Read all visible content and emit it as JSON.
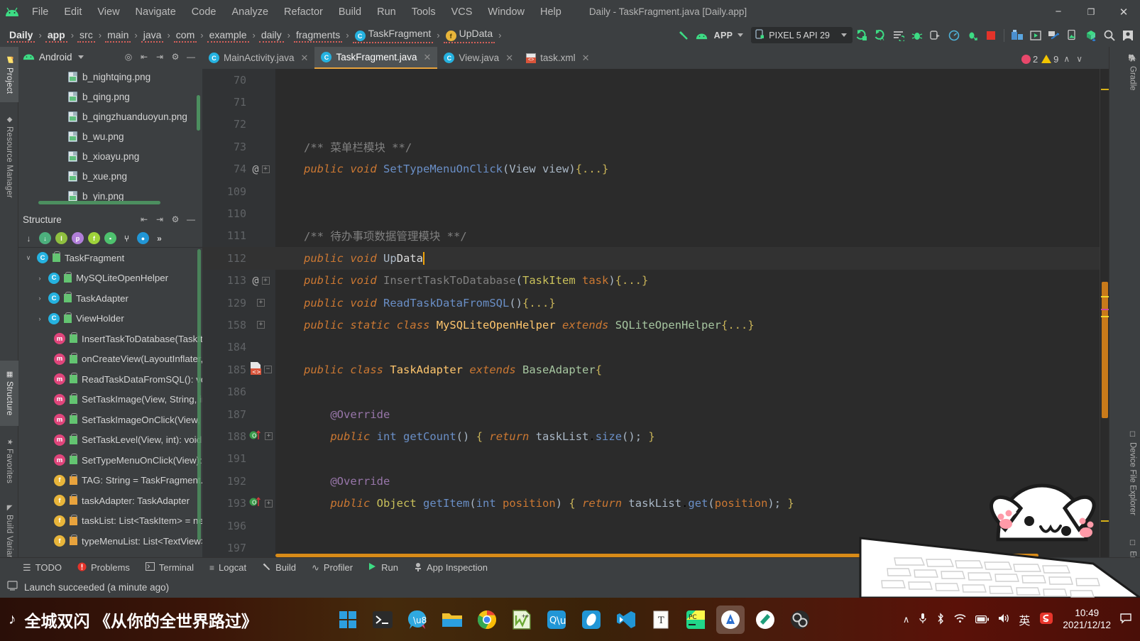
{
  "window": {
    "title": "Daily - TaskFragment.java [Daily.app]",
    "minimize": "−",
    "maximize": "❐",
    "close": "✕"
  },
  "menu": {
    "items": [
      "File",
      "Edit",
      "View",
      "Navigate",
      "Code",
      "Analyze",
      "Refactor",
      "Build",
      "Run",
      "Tools",
      "VCS",
      "Window",
      "Help"
    ]
  },
  "breadcrumb": {
    "items": [
      {
        "label": "Daily",
        "bold": true,
        "icon": null
      },
      {
        "label": "app",
        "bold": true,
        "icon": null
      },
      {
        "label": "src",
        "bold": false,
        "icon": null
      },
      {
        "label": "main",
        "bold": false,
        "icon": null
      },
      {
        "label": "java",
        "bold": false,
        "icon": null
      },
      {
        "label": "com",
        "bold": false,
        "icon": null
      },
      {
        "label": "example",
        "bold": false,
        "icon": null
      },
      {
        "label": "daily",
        "bold": false,
        "icon": null
      },
      {
        "label": "fragments",
        "bold": false,
        "icon": null
      },
      {
        "label": "TaskFragment",
        "bold": false,
        "icon": "class-icon"
      },
      {
        "label": "UpData",
        "bold": false,
        "icon": "field-icon"
      }
    ],
    "separator": "›"
  },
  "toolbar": {
    "build_label": "build-hammer-icon",
    "sync_label": "sync-gradle-icon",
    "run_config": "APP",
    "device": "PIXEL 5 API 29",
    "icons": [
      "run-icon",
      "run-coverage-icon",
      "apply-changes-icon",
      "debug-icon",
      "attach-debugger-icon",
      "profiler-icon",
      "apply-code-changes-icon",
      "stop-icon",
      "sdk-manager-icon",
      "avd-manager-icon",
      "layout-inspector-icon",
      "device-manager-icon",
      "project-structure-icon",
      "search-everywhere-icon",
      "account-icon"
    ]
  },
  "left_strip": {
    "tabs": [
      {
        "label": "Project",
        "icon": "folder-icon",
        "selected": true
      },
      {
        "label": "Resource Manager",
        "icon": "resource-icon",
        "selected": false
      },
      {
        "label": "Structure",
        "icon": "structure-icon",
        "selected": true
      },
      {
        "label": "Favorites",
        "icon": "star-icon",
        "selected": false
      },
      {
        "label": "Build Variants",
        "icon": "variants-icon",
        "selected": false
      }
    ]
  },
  "right_strip": {
    "tabs": [
      {
        "label": "Gradle",
        "icon": "gradle-elephant-icon"
      },
      {
        "label": "Device File Explorer",
        "icon": "device-file-icon"
      },
      {
        "label": "Emulator",
        "icon": "emulator-icon"
      }
    ]
  },
  "project_panel": {
    "title": "Android",
    "tools": [
      "locate-icon",
      "expand-all-icon",
      "collapse-all-icon",
      "settings-icon",
      "hide-icon"
    ],
    "files": [
      "b_nightqing.png",
      "b_qing.png",
      "b_qingzhuanduoyun.png",
      "b_wu.png",
      "b_xioayu.png",
      "b_xue.png",
      "b_yin.png"
    ]
  },
  "structure_panel": {
    "title": "Structure",
    "tools": [
      "expand-all-icon",
      "collapse-all-icon",
      "settings-icon",
      "hide-icon"
    ],
    "filters": [
      {
        "name": "sort-by-visibility-icon",
        "color": "#3c3f41",
        "glyph": "↓"
      },
      {
        "name": "sort-alphabetically-icon",
        "color": "#4caf7d",
        "glyph": "↓"
      },
      {
        "name": "show-inherited-icon",
        "color": "#8fbf3f",
        "glyph": "I"
      },
      {
        "name": "show-properties-icon",
        "color": "#b07ed8",
        "glyph": "p"
      },
      {
        "name": "show-fields-icon",
        "color": "#9fd33a",
        "glyph": "f"
      },
      {
        "name": "show-non-public-icon",
        "color": "#4ec16e",
        "glyph": "▪"
      },
      {
        "name": "show-hierarchy-icon",
        "color": "#3c3f41",
        "glyph": "⑂"
      },
      {
        "name": "show-anonymous-icon",
        "color": "#2196d6",
        "glyph": "●"
      },
      {
        "name": "more-icon",
        "color": "#3c3f41",
        "glyph": "»"
      }
    ],
    "nodes": [
      {
        "arrow": "∨",
        "kind": "C",
        "kcolor": "#25b2e0",
        "lock": "green",
        "label": "TaskFragment",
        "indent": 8
      },
      {
        "arrow": "›",
        "kind": "C",
        "kcolor": "#25b2e0",
        "lock": "green",
        "label": "MySQLiteOpenHelper",
        "indent": 24
      },
      {
        "arrow": "›",
        "kind": "C",
        "kcolor": "#25b2e0",
        "lock": "green",
        "label": "TaskAdapter",
        "indent": 24
      },
      {
        "arrow": "›",
        "kind": "C",
        "kcolor": "#25b2e0",
        "lock": "green",
        "label": "ViewHolder",
        "indent": 24
      },
      {
        "arrow": "",
        "kind": "m",
        "kcolor": "#e0457b",
        "lock": "green",
        "label": "InsertTaskToDatabase(TaskItem",
        "indent": 32
      },
      {
        "arrow": "",
        "kind": "m",
        "kcolor": "#e0457b",
        "lock": "green",
        "label": "onCreateView(LayoutInflater, Vi",
        "indent": 32
      },
      {
        "arrow": "",
        "kind": "m",
        "kcolor": "#e0457b",
        "lock": "green",
        "label": "ReadTaskDataFromSQL(): void",
        "indent": 32
      },
      {
        "arrow": "",
        "kind": "m",
        "kcolor": "#e0457b",
        "lock": "green",
        "label": "SetTaskImage(View, String, int):",
        "indent": 32
      },
      {
        "arrow": "",
        "kind": "m",
        "kcolor": "#e0457b",
        "lock": "green",
        "label": "SetTaskImageOnClick(View, Stri",
        "indent": 32
      },
      {
        "arrow": "",
        "kind": "m",
        "kcolor": "#e0457b",
        "lock": "green",
        "label": "SetTaskLevel(View, int): void",
        "indent": 32
      },
      {
        "arrow": "",
        "kind": "m",
        "kcolor": "#e0457b",
        "lock": "green",
        "label": "SetTypeMenuOnClick(View): vo",
        "indent": 32
      },
      {
        "arrow": "",
        "kind": "f",
        "kcolor": "#e8b53a",
        "lock": "orange",
        "label": "TAG: String = TaskFragment.cla",
        "indent": 32
      },
      {
        "arrow": "",
        "kind": "f",
        "kcolor": "#e8b53a",
        "lock": "orange",
        "label": "taskAdapter: TaskAdapter",
        "indent": 32
      },
      {
        "arrow": "",
        "kind": "f",
        "kcolor": "#e8b53a",
        "lock": "orange",
        "label": "taskList: List<TaskItem> = new",
        "indent": 32
      },
      {
        "arrow": "",
        "kind": "f",
        "kcolor": "#e8b53a",
        "lock": "orange",
        "label": "typeMenuList: List<TextView>",
        "indent": 32
      }
    ]
  },
  "editor": {
    "tabs": [
      {
        "label": "MainActivity.java",
        "icon": "java-class-icon",
        "active": false,
        "close": "✕"
      },
      {
        "label": "TaskFragment.java",
        "icon": "java-class-icon",
        "active": true,
        "close": "✕"
      },
      {
        "label": "View.java",
        "icon": "java-class-icon",
        "active": false,
        "close": "✕"
      },
      {
        "label": "task.xml",
        "icon": "xml-layout-icon",
        "active": false,
        "close": "✕"
      }
    ],
    "inspections": {
      "error_count": "2",
      "warning_count": "9",
      "prev": "∧",
      "next": "∨"
    },
    "lines": [
      {
        "num": "70",
        "gutter": "",
        "fold": false,
        "current": false,
        "html": ""
      },
      {
        "num": "71",
        "gutter": "",
        "fold": false,
        "current": false,
        "html": ""
      },
      {
        "num": "72",
        "gutter": "",
        "fold": false,
        "current": false,
        "html": ""
      },
      {
        "num": "73",
        "gutter": "",
        "fold": false,
        "current": false,
        "html": "<span class='cmt'>/** 菜单栏模块 **/</span>"
      },
      {
        "num": "74",
        "gutter": "@",
        "fold": true,
        "current": false,
        "html": "<span class='kw'>public</span> <span class='kw'>void</span> <span class='mth2'>SetTypeMenuOnClick</span><span class='brc'>(</span><span class='typ'>View</span> <span class='pln'>view</span><span class='brc'>)</span><span class='yel'>{...}</span>"
      },
      {
        "num": "109",
        "gutter": "",
        "fold": false,
        "current": false,
        "html": ""
      },
      {
        "num": "110",
        "gutter": "",
        "fold": false,
        "current": false,
        "html": ""
      },
      {
        "num": "111",
        "gutter": "",
        "fold": false,
        "current": false,
        "html": "<span class='cmt'>/** 待办事项数据管理模块 **/</span>"
      },
      {
        "num": "112",
        "gutter": "",
        "fold": false,
        "current": true,
        "html": "<span class='kw'>public</span> <span class='kw'>void</span> <span class='pln'>Up</span><span class='pln' style='color:#dcdcdc'>Data</span><span class='cursor'></span>"
      },
      {
        "num": "113",
        "gutter": "@",
        "fold": true,
        "current": false,
        "html": "<span class='kw'>public</span> <span class='kw'>void</span> <span class='gry'>InsertTaskToDatabase</span><span class='brc'>(</span><span class='typ' style='color:#c9c05a'>TaskItem</span> <span class='pln' style='color:#cc7832'>task</span><span class='brc'>)</span><span class='yel'>{...}</span>"
      },
      {
        "num": "129",
        "gutter": "",
        "fold": true,
        "current": false,
        "html": "<span class='kw'>public</span> <span class='kw'>void</span> <span class='mth2'>ReadTaskDataFromSQL</span><span class='brc'>()</span><span class='yel'>{...}</span>"
      },
      {
        "num": "158",
        "gutter": "",
        "fold": true,
        "current": false,
        "html": "<span class='kw'>public</span> <span class='kw'>static</span> <span class='kw'>class</span> <span class='mth'>MySQLiteOpenHelper</span> <span class='kw'>extends</span> <span class='pln' style='color:#a6c6a0'>SQLiteOpenHelper</span><span class='yel'>{...}</span>"
      },
      {
        "num": "184",
        "gutter": "",
        "fold": false,
        "current": false,
        "html": ""
      },
      {
        "num": "185",
        "gutter": "xml",
        "fold": true,
        "current": false,
        "html": "<span class='kw'>public</span> <span class='kw'>class</span> <span class='mth'>TaskAdapter</span> <span class='kw'>extends</span> <span class='pln' style='color:#a6c6a0'>BaseAdapter</span><span class='yel'>{</span>"
      },
      {
        "num": "186",
        "gutter": "",
        "fold": false,
        "current": false,
        "html": ""
      },
      {
        "num": "187",
        "gutter": "",
        "fold": false,
        "current": false,
        "html": "    <span class='pur'>@Override</span>"
      },
      {
        "num": "188",
        "gutter": "impl",
        "fold": true,
        "current": false,
        "html": "    <span class='kw'>public</span> <span class='kw2' style='color:#6a8fc7'>int</span> <span class='mth2'>getCount</span><span class='brc'>()</span> <span class='yel'>{</span> <span class='kw'>return</span> <span class='pln'>taskList</span>.<span class='mth2'>size</span><span class='brc'>();</span> <span class='yel'>}</span>"
      },
      {
        "num": "191",
        "gutter": "",
        "fold": false,
        "current": false,
        "html": ""
      },
      {
        "num": "192",
        "gutter": "",
        "fold": false,
        "current": false,
        "html": "    <span class='pur'>@Override</span>"
      },
      {
        "num": "193",
        "gutter": "impl",
        "fold": true,
        "current": false,
        "html": "    <span class='kw'>public</span> <span class='typ' style='color:#c9c05a'>Object</span> <span class='mth2'>getItem</span><span class='brc'>(</span><span class='kw2' style='color:#6a8fc7'>int</span> <span class='pln' style='color:#cc7832'>position</span><span class='brc'>)</span> <span class='yel'>{</span> <span class='kw'>return</span> <span class='pln'>taskList</span>.<span class='mth2'>get</span><span class='brc'>(</span><span class='pln' style='color:#cc7832'>position</span><span class='brc'>);</span> <span class='yel'>}</span>"
      },
      {
        "num": "196",
        "gutter": "",
        "fold": false,
        "current": false,
        "html": ""
      },
      {
        "num": "197",
        "gutter": "",
        "fold": false,
        "current": false,
        "html": ""
      }
    ]
  },
  "tool_windows": {
    "items": [
      {
        "label": "TODO",
        "icon": "todo-icon"
      },
      {
        "label": "Problems",
        "icon": "problems-icon"
      },
      {
        "label": "Terminal",
        "icon": "terminal-icon"
      },
      {
        "label": "Logcat",
        "icon": "logcat-icon"
      },
      {
        "label": "Build",
        "icon": "build-hammer-icon"
      },
      {
        "label": "Profiler",
        "icon": "profiler-icon"
      },
      {
        "label": "Run",
        "icon": "run-icon"
      },
      {
        "label": "App Inspection",
        "icon": "app-inspection-icon"
      }
    ]
  },
  "status_bar": {
    "icon": "event-log-icon",
    "message": "Launch succeeded (a minute ago)"
  },
  "taskbar": {
    "media": {
      "note_icon": "music-note-icon",
      "text": "全城双闪 《从你的全世界路过》"
    },
    "apps": [
      {
        "name": "start-button-icon",
        "selected": false
      },
      {
        "name": "terminal-icon",
        "selected": false
      },
      {
        "name": "translate-icon",
        "selected": false
      },
      {
        "name": "file-explorer-icon",
        "selected": false
      },
      {
        "name": "chrome-icon",
        "selected": false
      },
      {
        "name": "notepad-plus-plus-icon",
        "selected": false
      },
      {
        "name": "qq-music-icon",
        "selected": false
      },
      {
        "name": "eclipse-icon",
        "selected": false
      },
      {
        "name": "vscode-icon",
        "selected": false
      },
      {
        "name": "typora-icon",
        "selected": false
      },
      {
        "name": "pycharm-icon",
        "selected": false
      },
      {
        "name": "android-studio-icon",
        "selected": true
      },
      {
        "name": "navicat-icon",
        "selected": false
      },
      {
        "name": "obs-icon",
        "selected": false
      }
    ],
    "tray": {
      "overflow": "∧",
      "icons": [
        "microphone-icon",
        "bluetooth-icon",
        "wifi-icon",
        "battery-icon",
        "volume-icon"
      ],
      "ime": "英",
      "sogou": "S",
      "time": "10:49",
      "date": "2021/12/12",
      "notification": "notification-icon"
    }
  }
}
